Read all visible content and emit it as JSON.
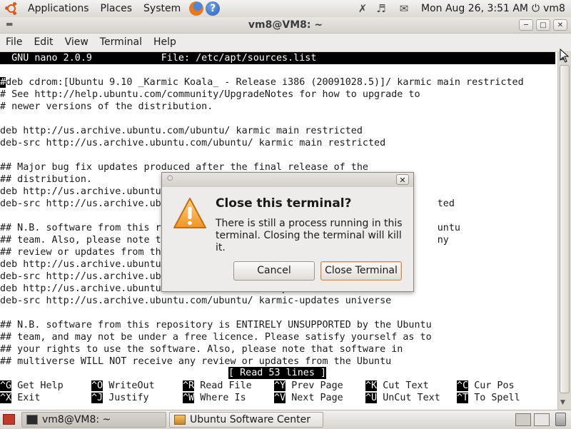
{
  "top_panel": {
    "menus": [
      "Applications",
      "Places",
      "System"
    ],
    "clock": "Mon Aug 26,  3:51 AM",
    "user": "vm8"
  },
  "window": {
    "title": "vm8@VM8: ~",
    "menus": [
      "File",
      "Edit",
      "View",
      "Terminal",
      "Help"
    ]
  },
  "nano": {
    "header": "  GNU nano 2.0.9            File: /etc/apt/sources.list",
    "lines": [
      "#deb cdrom:[Ubuntu 9.10 _Karmic Koala_ - Release i386 (20091028.5)]/ karmic main restricted",
      "# See http://help.ubuntu.com/community/UpgradeNotes for how to upgrade to",
      "# newer versions of the distribution.",
      "",
      "deb http://us.archive.ubuntu.com/ubuntu/ karmic main restricted",
      "deb-src http://us.archive.ubuntu.com/ubuntu/ karmic main restricted",
      "",
      "## Major bug fix updates produced after the final release of the",
      "## distribution.",
      "deb http://us.archive.ubuntu",
      "deb-src http://us.archive.ub                                                ted",
      "",
      "## N.B. software from this r                                                untu",
      "## team. Also, please note t                                                ny",
      "## review or updates from th",
      "deb http://us.archive.ubuntu",
      "deb-src http://us.archive.ub",
      "deb http://us.archive.ubuntu.com/ubuntu/ karmic-updates universe",
      "deb-src http://us.archive.ubuntu.com/ubuntu/ karmic-updates universe",
      "",
      "## N.B. software from this repository is ENTIRELY UNSUPPORTED by the Ubuntu",
      "## team, and may not be under a free licence. Please satisfy yourself as to",
      "## your rights to use the software. Also, please note that software in",
      "## multiverse WILL NOT receive any review or updates from the Ubuntu"
    ],
    "status": "[ Read 53 lines ]",
    "shortcuts_row1": [
      {
        "key": "^G",
        "label": "Get Help"
      },
      {
        "key": "^O",
        "label": "WriteOut"
      },
      {
        "key": "^R",
        "label": "Read File"
      },
      {
        "key": "^Y",
        "label": "Prev Page"
      },
      {
        "key": "^K",
        "label": "Cut Text"
      },
      {
        "key": "^C",
        "label": "Cur Pos"
      }
    ],
    "shortcuts_row2": [
      {
        "key": "^X",
        "label": "Exit"
      },
      {
        "key": "^J",
        "label": "Justify"
      },
      {
        "key": "^W",
        "label": "Where Is"
      },
      {
        "key": "^V",
        "label": "Next Page"
      },
      {
        "key": "^U",
        "label": "UnCut Text"
      },
      {
        "key": "^T",
        "label": "To Spell"
      }
    ]
  },
  "dialog": {
    "heading": "Close this terminal?",
    "message": "There is still a process running in this terminal. Closing the terminal will kill it.",
    "cancel_label": "Cancel",
    "confirm_label": "Close Terminal"
  },
  "taskbar": {
    "tasks": [
      "vm8@VM8: ~",
      "Ubuntu Software Center"
    ]
  }
}
